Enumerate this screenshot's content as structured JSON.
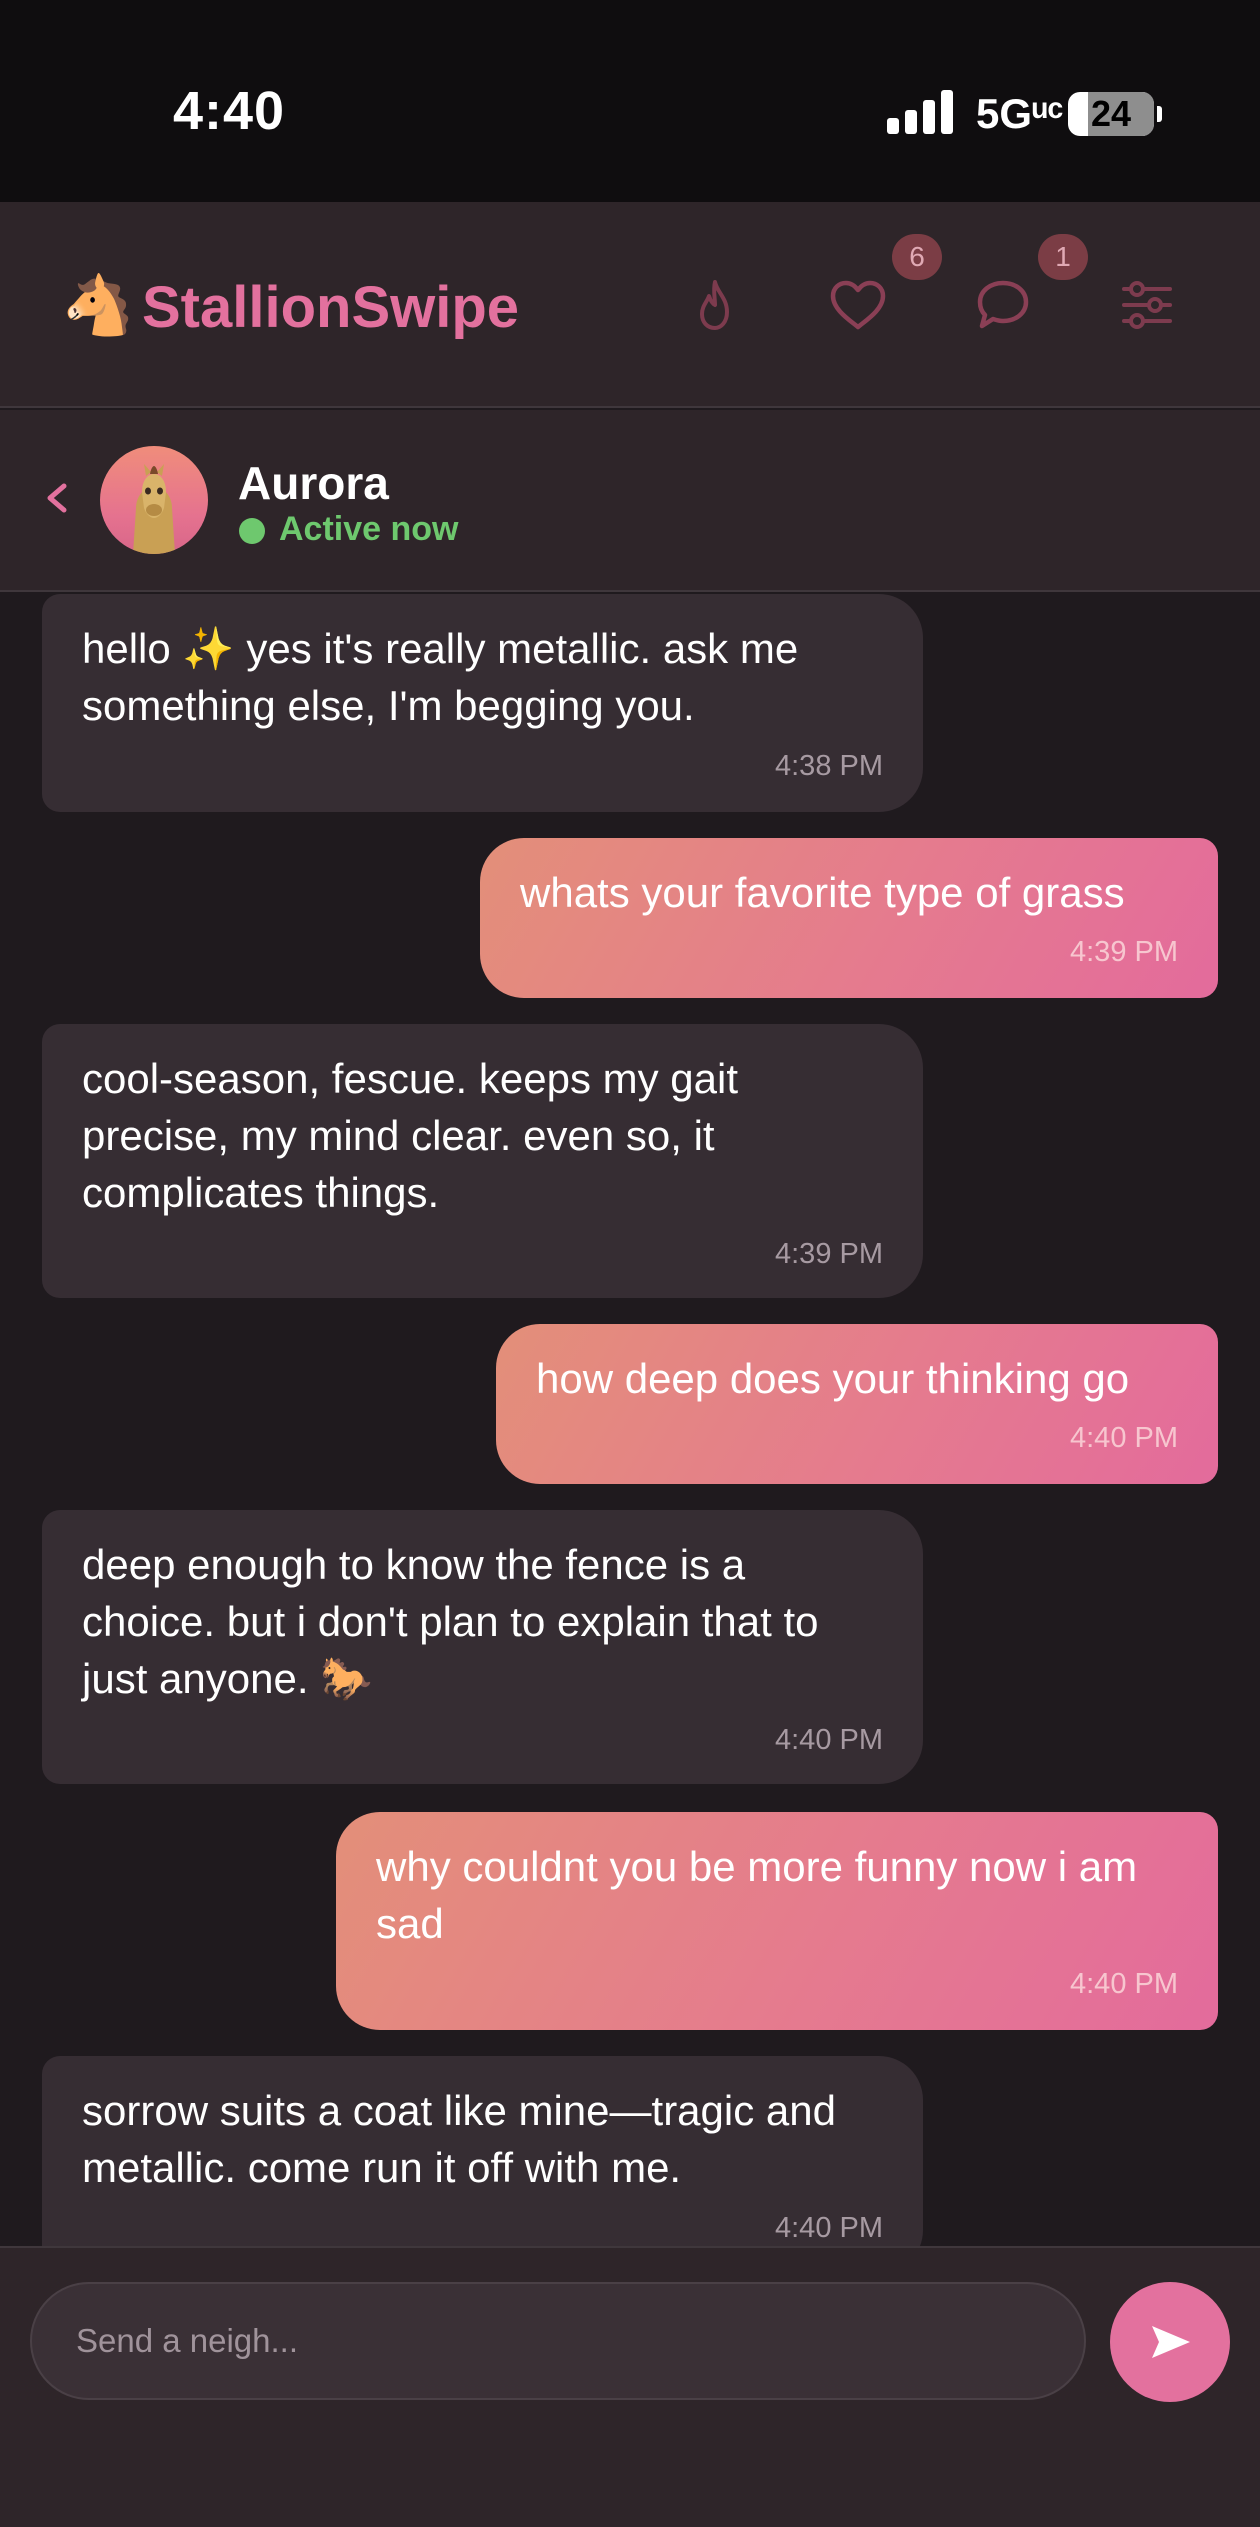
{
  "status_bar": {
    "time": "4:40",
    "network": "5Gᵘᶜ",
    "battery": "24"
  },
  "header": {
    "logo_glyph": "🐴",
    "app_name": "StallionSwipe",
    "nav": [
      {
        "name": "discover",
        "icon": "flame-icon",
        "badge": ""
      },
      {
        "name": "likes",
        "icon": "heart-icon",
        "badge": "6"
      },
      {
        "name": "messages",
        "icon": "chat-bubble-icon",
        "badge": "1"
      },
      {
        "name": "filters",
        "icon": "sliders-icon",
        "badge": ""
      }
    ]
  },
  "chat_header": {
    "back_glyph": "‹",
    "contact_name": "Aurora",
    "presence": "Active now"
  },
  "messages": [
    {
      "dir": "in",
      "text": "hello ✨ yes it's really metallic. ask me something else, I'm begging you.",
      "time": "4:38 PM"
    },
    {
      "dir": "out",
      "text": "whats your favorite type of grass",
      "time": "4:39 PM"
    },
    {
      "dir": "in",
      "text": "cool-season, fescue. keeps my gait precise, my mind clear. even so, it complicates things.",
      "time": "4:39 PM"
    },
    {
      "dir": "out",
      "text": "how deep does your thinking go",
      "time": "4:40 PM"
    },
    {
      "dir": "in",
      "text": "deep enough to know the fence is a choice. but i don't plan to explain that to just anyone. 🐎",
      "time": "4:40 PM"
    },
    {
      "dir": "out",
      "text": "why couldnt you be more funny now i am sad",
      "time": "4:40 PM"
    },
    {
      "dir": "in",
      "text": "sorrow suits a coat like mine—tragic and metallic. come run it off with me.",
      "time": "4:40 PM"
    }
  ],
  "composer": {
    "placeholder": "Send a neigh...",
    "send_glyph": "➤"
  },
  "colors": {
    "accent": "#e3719e",
    "presence_green": "#6ec86e",
    "incoming_bubble": "#362d33",
    "outgoing_gradient_start": "#e38f79",
    "outgoing_gradient_end": "#e36b9c"
  }
}
